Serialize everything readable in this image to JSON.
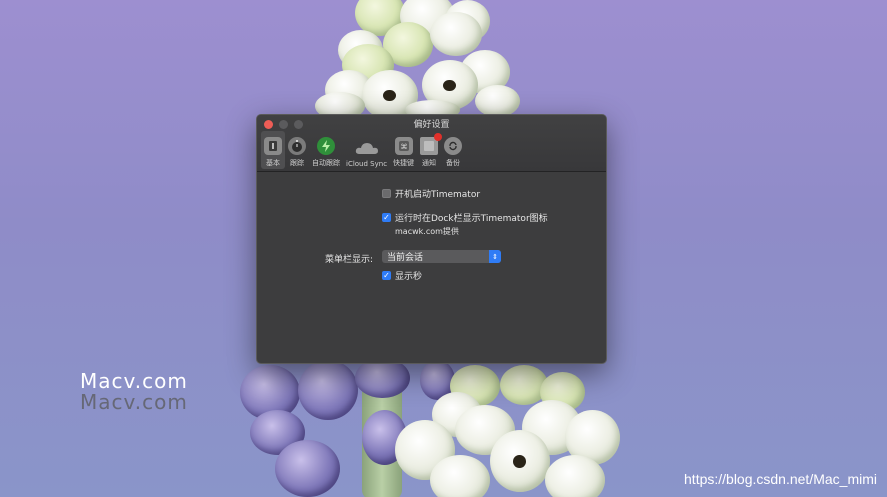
{
  "window": {
    "title": "偏好设置"
  },
  "toolbar": {
    "items": [
      {
        "label": "基本",
        "icon": "basic-settings-icon",
        "active": true
      },
      {
        "label": "跟踪",
        "icon": "stopwatch-icon",
        "active": false
      },
      {
        "label": "自动跟踪",
        "icon": "auto-track-icon",
        "active": false
      },
      {
        "label": "iCloud Sync",
        "icon": "cloud-icon",
        "active": false
      },
      {
        "label": "快捷键",
        "icon": "keyboard-icon",
        "active": false
      },
      {
        "label": "通知",
        "icon": "notification-icon",
        "active": false
      },
      {
        "label": "备份",
        "icon": "backup-icon",
        "active": false
      }
    ]
  },
  "settings": {
    "launch_at_login": {
      "label": "开机启动Timemator",
      "checked": false
    },
    "show_dock_icon": {
      "label": "运行时在Dock栏显示Timemator图标",
      "checked": true,
      "note": "macwk.com提供"
    },
    "menubar_display": {
      "label": "菜单栏显示:",
      "value": "当前会话"
    },
    "show_seconds": {
      "label": "显示秒",
      "checked": true
    }
  },
  "watermark": {
    "line1": "Macv.com",
    "line2": "Macv.com"
  },
  "credit": "https://blog.csdn.net/Mac_mimi",
  "colors": {
    "accent": "#2f7cf6",
    "window_bg": "#3d3d3e",
    "close": "#ee5d56"
  }
}
